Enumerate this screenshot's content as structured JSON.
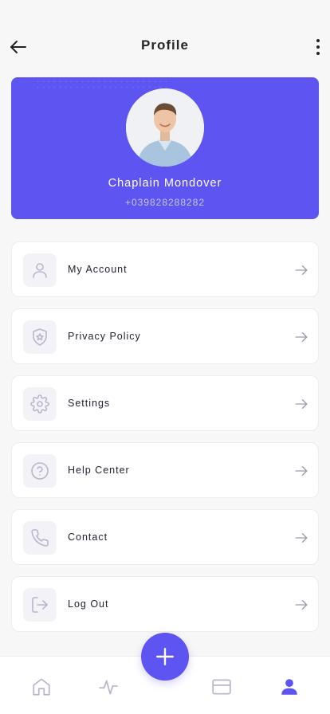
{
  "header": {
    "title": "Profile"
  },
  "profile": {
    "name": "Chaplain Mondover",
    "phone": "+039828288282"
  },
  "menu": {
    "items": [
      {
        "label": "My Account",
        "icon": "user-icon"
      },
      {
        "label": "Privacy Policy",
        "icon": "shield-star-icon"
      },
      {
        "label": "Settings",
        "icon": "gear-icon"
      },
      {
        "label": "Help Center",
        "icon": "question-circle-icon"
      },
      {
        "label": "Contact",
        "icon": "phone-icon"
      },
      {
        "label": "Log Out",
        "icon": "logout-icon"
      }
    ]
  },
  "bottom_nav": {
    "items": [
      "home-icon",
      "activity-icon",
      "add-icon",
      "wallet-icon",
      "profile-icon"
    ],
    "active": "profile-icon"
  },
  "colors": {
    "accent": "#5d54f2",
    "icon_muted": "#b8b6cc",
    "background": "#f7f7f7"
  }
}
